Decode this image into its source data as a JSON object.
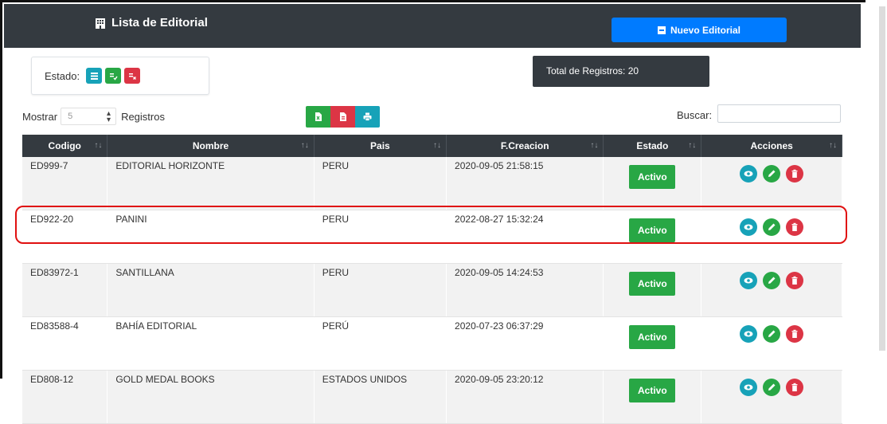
{
  "header": {
    "title": "Lista de Editorial",
    "new_button": "Nuevo Editorial"
  },
  "estado_filter": {
    "label": "Estado:"
  },
  "total": {
    "text": "Total de Registros: 20"
  },
  "length": {
    "prefix": "Mostrar",
    "value": "5",
    "suffix": "Registros"
  },
  "search": {
    "label": "Buscar:",
    "value": ""
  },
  "table": {
    "columns": [
      "Codigo",
      "Nombre",
      "Pais",
      "F.Creacion",
      "Estado",
      "Acciones"
    ],
    "rows": [
      {
        "codigo": "ED999-7",
        "nombre": "EDITORIAL HORIZONTE",
        "pais": "PERU",
        "fecha": "2020-09-05 21:58:15",
        "estado": "Activo"
      },
      {
        "codigo": "ED922-20",
        "nombre": "PANINI",
        "pais": "PERU",
        "fecha": "2022-08-27 15:32:24",
        "estado": "Activo"
      },
      {
        "codigo": "ED83972-1",
        "nombre": "SANTILLANA",
        "pais": "PERU",
        "fecha": "2020-09-05 14:24:53",
        "estado": "Activo"
      },
      {
        "codigo": "ED83588-4",
        "nombre": "BAHÍA EDITORIAL",
        "pais": "PERÚ",
        "fecha": "2020-07-23 06:37:29",
        "estado": "Activo"
      },
      {
        "codigo": "ED808-12",
        "nombre": "GOLD MEDAL BOOKS",
        "pais": "ESTADOS UNIDOS",
        "fecha": "2020-09-05 23:20:12",
        "estado": "Activo"
      }
    ]
  },
  "icons": {
    "header": "building-icon",
    "new": "square-plus-icon",
    "estado_all": "list-icon",
    "estado_active": "check-list-icon",
    "estado_inactive": "x-list-icon",
    "export_excel": "excel-file-icon",
    "export_pdf": "pdf-file-icon",
    "print": "print-icon",
    "view": "eye-icon",
    "edit": "pencil-icon",
    "delete": "trash-icon"
  },
  "colors": {
    "dark": "#343a40",
    "primary": "#007bff",
    "success": "#28a745",
    "danger": "#dc3545",
    "info": "#17a2b8",
    "highlight": "#e01010"
  }
}
